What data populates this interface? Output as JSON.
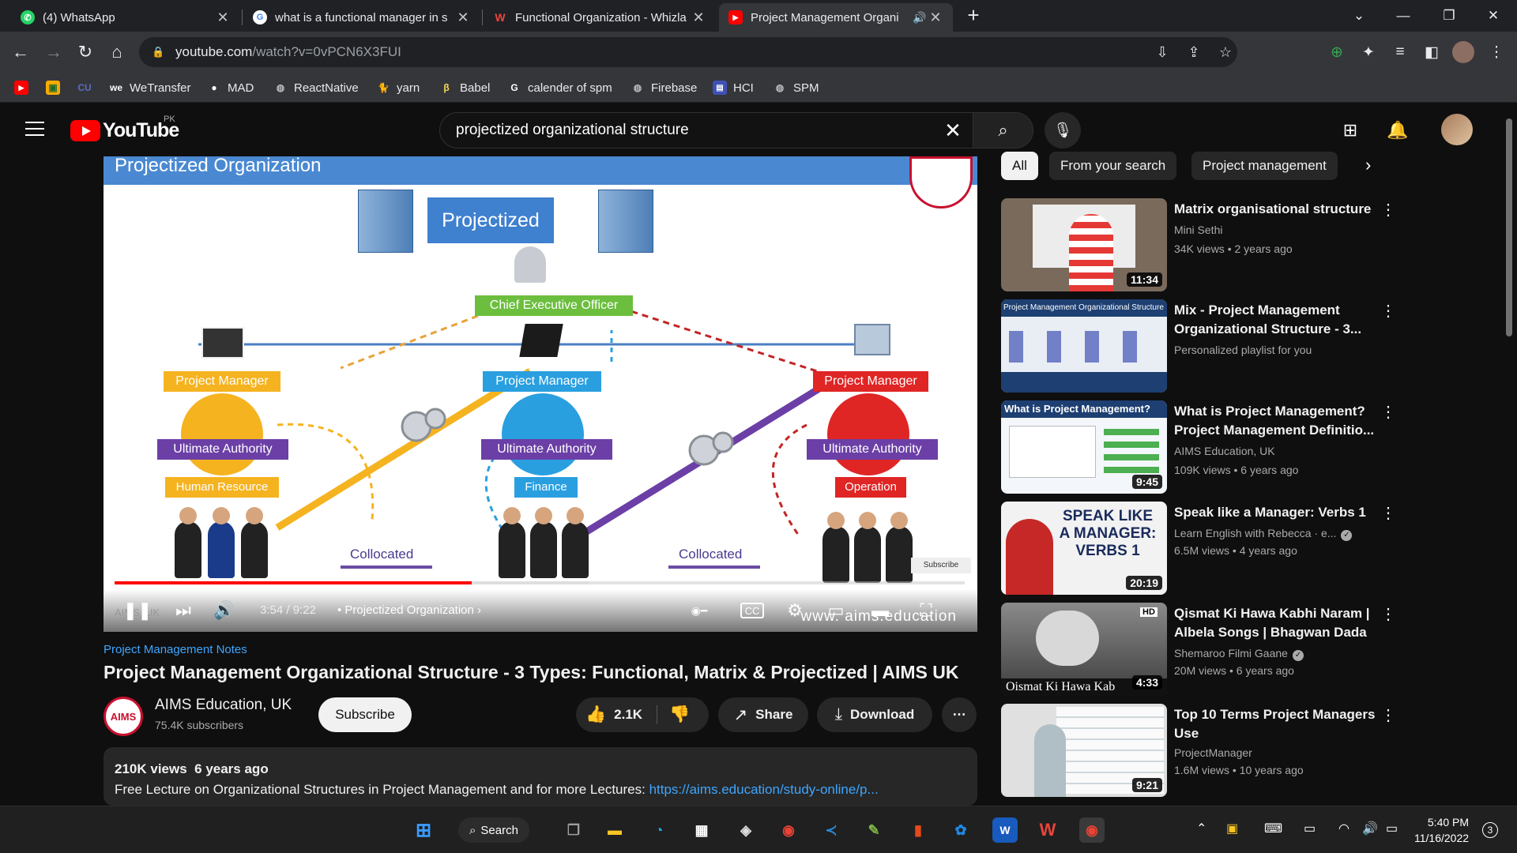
{
  "browser": {
    "tabs": [
      {
        "title": "(4) WhatsApp"
      },
      {
        "title": "what is a functional manager in s"
      },
      {
        "title": "Functional Organization - Whizla"
      },
      {
        "title": "Project Management Organi"
      }
    ],
    "url_host": "youtube.com",
    "url_path": "/watch?v=0vPCN6X3FUI",
    "bookmarks": [
      "WeTransfer",
      "MAD",
      "ReactNative",
      "yarn",
      "Babel",
      "calender of spm",
      "Firebase",
      "HCI",
      "SPM"
    ]
  },
  "youtube": {
    "logo_text": "YouTube",
    "country_code": "PK",
    "search_query": "projectized organizational structure"
  },
  "player": {
    "slide_title": "Projectized Organization",
    "center_label": "Projectized",
    "ceo_label": "Chief Executive Officer",
    "columns": [
      {
        "pm": "Project Manager",
        "authority": "Ultimate Authority",
        "dept": "Human Resource",
        "color": "#f5b320"
      },
      {
        "pm": "Project Manager",
        "authority": "Ultimate Authority",
        "dept": "Finance",
        "color": "#2a9fe0"
      },
      {
        "pm": "Project Manager",
        "authority": "Ultimate Authority",
        "dept": "Operation",
        "color": "#e02525"
      }
    ],
    "collocated_label": "Collocated",
    "current_time": "3:54",
    "duration": "9:22",
    "chapter": "Projectized Organization",
    "watermark": "www. aims.education",
    "corner_text": "AIMS, UK",
    "subscribe_stamp": "Subscribe",
    "progress_fraction": 0.42
  },
  "video": {
    "tagline": "Project Management Notes",
    "title": "Project Management Organizational Structure - 3 Types: Functional, Matrix & Projectized | AIMS UK",
    "channel": "AIMS Education, UK",
    "subscribers": "75.4K subscribers",
    "subscribe_label": "Subscribe",
    "likes": "2.1K",
    "share_label": "Share",
    "download_label": "Download",
    "views": "210K views",
    "age": "6 years ago",
    "description": "Free Lecture on Organizational Structures in Project Management and for more Lectures:",
    "description_link": "https://aims.education/study-online/p..."
  },
  "chips": [
    "All",
    "From your search",
    "Project management"
  ],
  "recommendations": [
    {
      "title": "Matrix organisational structure",
      "channel": "Mini Sethi",
      "meta": "34K views • 2 years ago",
      "duration": "11:34",
      "thumb": "#7a6a5c"
    },
    {
      "title": "Mix - Project Management Organizational Structure - 3...",
      "channel": "Personalized playlist for you",
      "meta": "",
      "duration": "",
      "thumb": "#1d3f72",
      "thumb_text": "Project Management Organizational Structure"
    },
    {
      "title": "What is Project Management? Project Management Definitio...",
      "channel": "AIMS Education, UK",
      "meta": "109K views • 6 years ago",
      "duration": "9:45",
      "thumb": "#e8eef5",
      "thumb_text": "What is Project Management?"
    },
    {
      "title": "Speak like a Manager: Verbs 1",
      "channel": "Learn English with Rebecca · e...",
      "meta": "6.5M views • 4 years ago",
      "duration": "20:19",
      "thumb": "#f2f2f2",
      "thumb_text": "SPEAK LIKE A MANAGER: VERBS 1"
    },
    {
      "title": "Qismat Ki Hawa Kabhi Naram | Albela Songs | Bhagwan Dada ...",
      "channel": "Shemaroo Filmi Gaane",
      "meta": "20M views • 6 years ago",
      "duration": "4:33",
      "thumb": "#6d6d6d",
      "thumb_text": "Oismat Ki Hawa Kab"
    },
    {
      "title": "Top 10 Terms Project Managers Use",
      "channel": "ProjectManager",
      "meta": "1.6M views • 10 years ago",
      "duration": "9:21",
      "thumb": "#d9d9d9"
    }
  ],
  "taskbar": {
    "search_label": "Search",
    "time": "5:40 PM",
    "date": "11/16/2022",
    "notifications": "3"
  }
}
